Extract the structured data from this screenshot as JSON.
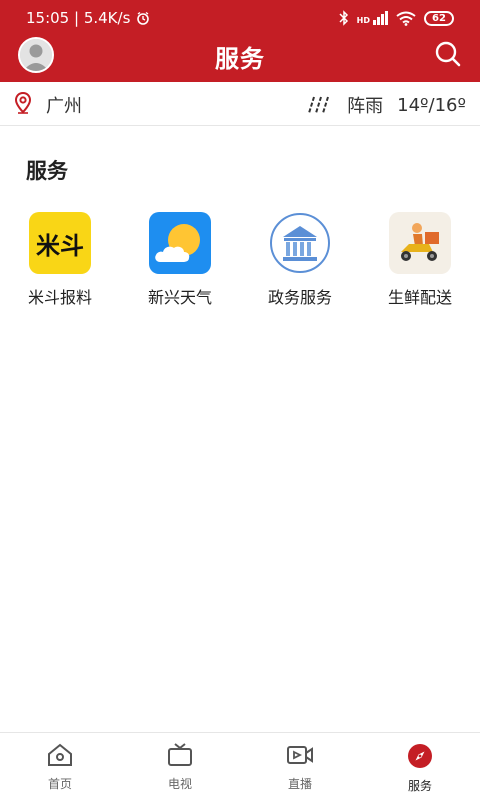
{
  "status_bar": {
    "time_speed": "15:05 | 5.4K/s",
    "signal_label": "HD",
    "battery": "62"
  },
  "header": {
    "title": "服务"
  },
  "weather": {
    "city": "广州",
    "condition": "阵雨",
    "temperature": "14º/16º"
  },
  "section": {
    "title": "服务"
  },
  "services": [
    {
      "label": "米斗报料",
      "icon": "mi-dou-logo-icon",
      "icon_text": "米斗"
    },
    {
      "label": "新兴天气",
      "icon": "weather-sun-cloud-icon"
    },
    {
      "label": "政务服务",
      "icon": "government-building-icon"
    },
    {
      "label": "生鲜配送",
      "icon": "delivery-scooter-icon"
    }
  ],
  "bottom_nav": [
    {
      "label": "首页",
      "icon": "home-icon"
    },
    {
      "label": "电视",
      "icon": "tv-icon"
    },
    {
      "label": "直播",
      "icon": "live-video-icon"
    },
    {
      "label": "服务",
      "icon": "compass-icon",
      "active": true
    }
  ],
  "colors": {
    "brand_red": "#c41e25",
    "active_nav": "#c41e25",
    "inactive_nav": "#666666"
  }
}
